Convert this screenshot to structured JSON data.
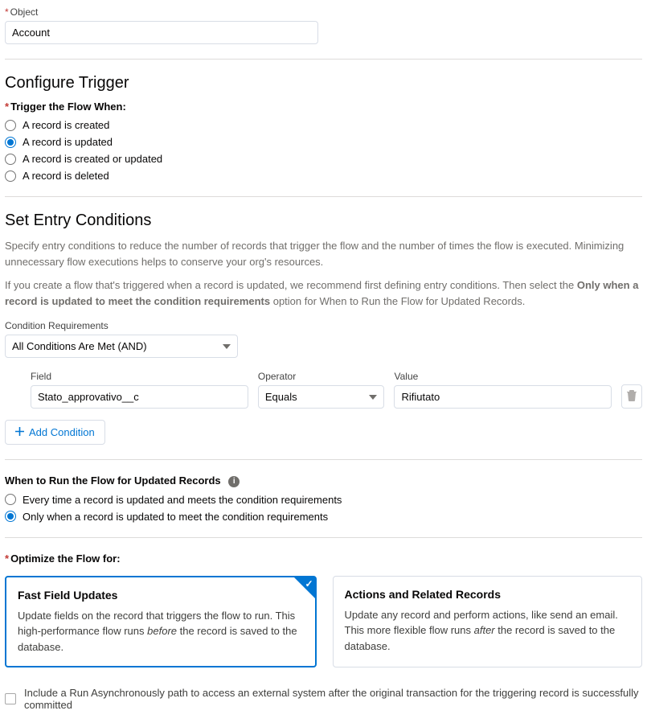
{
  "object": {
    "label": "Object",
    "value": "Account"
  },
  "configureTrigger": {
    "title": "Configure Trigger",
    "whenLabel": "Trigger the Flow When:",
    "options": {
      "created": "A record is created",
      "updated": "A record is updated",
      "createdOrUpdated": "A record is created or updated",
      "deleted": "A record is deleted"
    },
    "selected": "updated"
  },
  "entryConditions": {
    "title": "Set Entry Conditions",
    "help1": "Specify entry conditions to reduce the number of records that trigger the flow and the number of times the flow is executed. Minimizing unnecessary flow executions helps to conserve your org's resources.",
    "help2_pre": "If you create a flow that's triggered when a record is updated, we recommend first defining entry conditions. Then select the ",
    "help2_bold": "Only when a record is updated to meet the condition requirements",
    "help2_post": " option for When to Run the Flow for Updated Records.",
    "reqLabel": "Condition Requirements",
    "reqValue": "All Conditions Are Met (AND)",
    "row": {
      "fieldLabel": "Field",
      "fieldValue": "Stato_approvativo__c",
      "opLabel": "Operator",
      "opValue": "Equals",
      "valLabel": "Value",
      "valValue": "Rifiutato"
    },
    "addCondition": "Add Condition"
  },
  "whenToRun": {
    "heading": "When to Run the Flow for Updated Records",
    "options": {
      "every": "Every time a record is updated and meets the condition requirements",
      "only": "Only when a record is updated to meet the condition requirements"
    },
    "selected": "only"
  },
  "optimize": {
    "heading": "Optimize the Flow for:",
    "fast": {
      "title": "Fast Field Updates",
      "desc_pre": "Update fields on the record that triggers the flow to run. This high-performance flow runs ",
      "desc_em": "before",
      "desc_post": " the record is saved to the database."
    },
    "actions": {
      "title": "Actions and Related Records",
      "desc_pre": "Update any record and perform actions, like send an email. This more flexible flow runs ",
      "desc_em": "after",
      "desc_post": " the record is saved to the database."
    },
    "selected": "fast"
  },
  "async": {
    "label": "Include a Run Asynchronously path to access an external system after the original transaction for the triggering record is successfully committed"
  }
}
